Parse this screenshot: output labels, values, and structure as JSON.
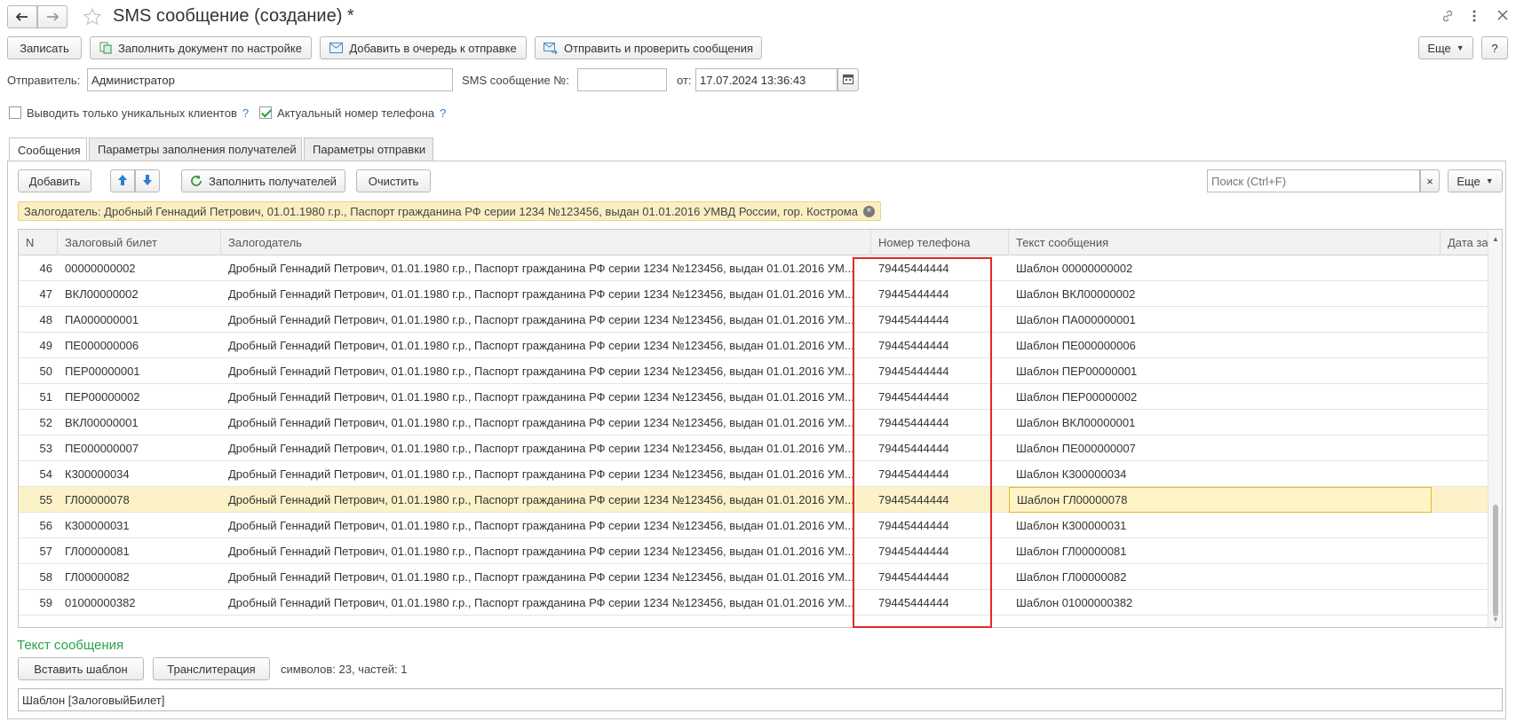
{
  "window": {
    "title": "SMS сообщение (создание) *"
  },
  "toolbar": {
    "save": "Записать",
    "fill_by_settings": "Заполнить документ по настройке",
    "add_to_queue": "Добавить в очередь к отправке",
    "send_and_check": "Отправить и проверить сообщения",
    "more": "Еще",
    "help": "?"
  },
  "form": {
    "sender_label": "Отправитель:",
    "sender_value": "Администратор",
    "sms_number_label": "SMS сообщение №:",
    "sms_number_value": "",
    "date_label": "от:",
    "date_value": "17.07.2024 13:36:43",
    "unique_clients_label": "Выводить только уникальных клиентов",
    "unique_clients_checked": false,
    "actual_phone_label": "Актуальный номер телефона",
    "actual_phone_checked": true,
    "help_mark": "?"
  },
  "tabs": [
    {
      "label": "Сообщения",
      "active": true
    },
    {
      "label": "Параметры заполнения получателей",
      "active": false
    },
    {
      "label": "Параметры отправки",
      "active": false
    }
  ],
  "messages_toolbar": {
    "add": "Добавить",
    "fill_recipients": "Заполнить получателей",
    "clear": "Очистить",
    "search_placeholder": "Поиск (Ctrl+F)",
    "clear_search": "×",
    "more": "Еще"
  },
  "filter": {
    "text": "Залогодатель: Дробный Геннадий Петрович, 01.01.1980 г.р., Паспорт гражданина РФ серии 1234 №123456, выдан 01.01.2016 УМВД России, гор. Кострома"
  },
  "table": {
    "columns": [
      "N",
      "Залоговый билет",
      "Залогодатель",
      "Номер телефона",
      "Текст сообщения",
      "Дата за..."
    ],
    "rows": [
      {
        "n": "46",
        "ticket": "00000000002",
        "pledger": "Дробный Геннадий Петрович, 01.01.1980 г.р., Паспорт гражданина РФ серии 1234 №123456, выдан 01.01.2016 УМ...",
        "phone": "79445444444",
        "text": "Шаблон 00000000002"
      },
      {
        "n": "47",
        "ticket": "ВКЛ00000002",
        "pledger": "Дробный Геннадий Петрович, 01.01.1980 г.р., Паспорт гражданина РФ серии 1234 №123456, выдан 01.01.2016 УМ...",
        "phone": "79445444444",
        "text": "Шаблон ВКЛ00000002"
      },
      {
        "n": "48",
        "ticket": "ПА000000001",
        "pledger": "Дробный Геннадий Петрович, 01.01.1980 г.р., Паспорт гражданина РФ серии 1234 №123456, выдан 01.01.2016 УМ...",
        "phone": "79445444444",
        "text": "Шаблон ПА000000001"
      },
      {
        "n": "49",
        "ticket": "ПЕ000000006",
        "pledger": "Дробный Геннадий Петрович, 01.01.1980 г.р., Паспорт гражданина РФ серии 1234 №123456, выдан 01.01.2016 УМ...",
        "phone": "79445444444",
        "text": "Шаблон ПЕ000000006"
      },
      {
        "n": "50",
        "ticket": "ПЕР00000001",
        "pledger": "Дробный Геннадий Петрович, 01.01.1980 г.р., Паспорт гражданина РФ серии 1234 №123456, выдан 01.01.2016 УМ...",
        "phone": "79445444444",
        "text": "Шаблон ПЕР00000001"
      },
      {
        "n": "51",
        "ticket": "ПЕР00000002",
        "pledger": "Дробный Геннадий Петрович, 01.01.1980 г.р., Паспорт гражданина РФ серии 1234 №123456, выдан 01.01.2016 УМ...",
        "phone": "79445444444",
        "text": "Шаблон ПЕР00000002"
      },
      {
        "n": "52",
        "ticket": "ВКЛ00000001",
        "pledger": "Дробный Геннадий Петрович, 01.01.1980 г.р., Паспорт гражданина РФ серии 1234 №123456, выдан 01.01.2016 УМ...",
        "phone": "79445444444",
        "text": "Шаблон ВКЛ00000001"
      },
      {
        "n": "53",
        "ticket": "ПЕ000000007",
        "pledger": "Дробный Геннадий Петрович, 01.01.1980 г.р., Паспорт гражданина РФ серии 1234 №123456, выдан 01.01.2016 УМ...",
        "phone": "79445444444",
        "text": "Шаблон ПЕ000000007"
      },
      {
        "n": "54",
        "ticket": "К300000034",
        "pledger": "Дробный Геннадий Петрович, 01.01.1980 г.р., Паспорт гражданина РФ серии 1234 №123456, выдан 01.01.2016 УМ...",
        "phone": "79445444444",
        "text": "Шаблон К300000034"
      },
      {
        "n": "55",
        "ticket": "ГЛ00000078",
        "pledger": "Дробный Геннадий Петрович, 01.01.1980 г.р., Паспорт гражданина РФ серии 1234 №123456, выдан 01.01.2016 УМ...",
        "phone": "79445444444",
        "text": "Шаблон ГЛ00000078",
        "selected": true
      },
      {
        "n": "56",
        "ticket": "К300000031",
        "pledger": "Дробный Геннадий Петрович, 01.01.1980 г.р., Паспорт гражданина РФ серии 1234 №123456, выдан 01.01.2016 УМ...",
        "phone": "79445444444",
        "text": "Шаблон К300000031"
      },
      {
        "n": "57",
        "ticket": "ГЛ00000081",
        "pledger": "Дробный Геннадий Петрович, 01.01.1980 г.р., Паспорт гражданина РФ серии 1234 №123456, выдан 01.01.2016 УМ...",
        "phone": "79445444444",
        "text": "Шаблон ГЛ00000081"
      },
      {
        "n": "58",
        "ticket": "ГЛ00000082",
        "pledger": "Дробный Геннадий Петрович, 01.01.1980 г.р., Паспорт гражданина РФ серии 1234 №123456, выдан 01.01.2016 УМ...",
        "phone": "79445444444",
        "text": "Шаблон ГЛ00000082"
      },
      {
        "n": "59",
        "ticket": "01000000382",
        "pledger": "Дробный Геннадий Петрович, 01.01.1980 г.р., Паспорт гражданина РФ серии 1234 №123456, выдан 01.01.2016 УМ...",
        "phone": "79445444444",
        "text": "Шаблон 01000000382"
      }
    ]
  },
  "message_text": {
    "heading": "Текст сообщения",
    "insert_template": "Вставить шаблон",
    "transliteration": "Транслитерация",
    "stats": "символов: 23, частей: 1",
    "value": "Шаблон [ЗалоговыйБилет]"
  },
  "colors": {
    "accent_green": "#27a24a",
    "highlight_red": "#e32828",
    "selected_row": "#fcf2c8"
  },
  "icons": [
    "back-arrow-icon",
    "forward-arrow-icon",
    "star-icon",
    "link-icon",
    "kebab-menu-icon",
    "close-icon",
    "fill-doc-icon",
    "envelope-icon",
    "send-icon",
    "calendar-icon",
    "arrow-up-icon",
    "arrow-down-icon",
    "refresh-icon",
    "scroll-up-icon"
  ]
}
